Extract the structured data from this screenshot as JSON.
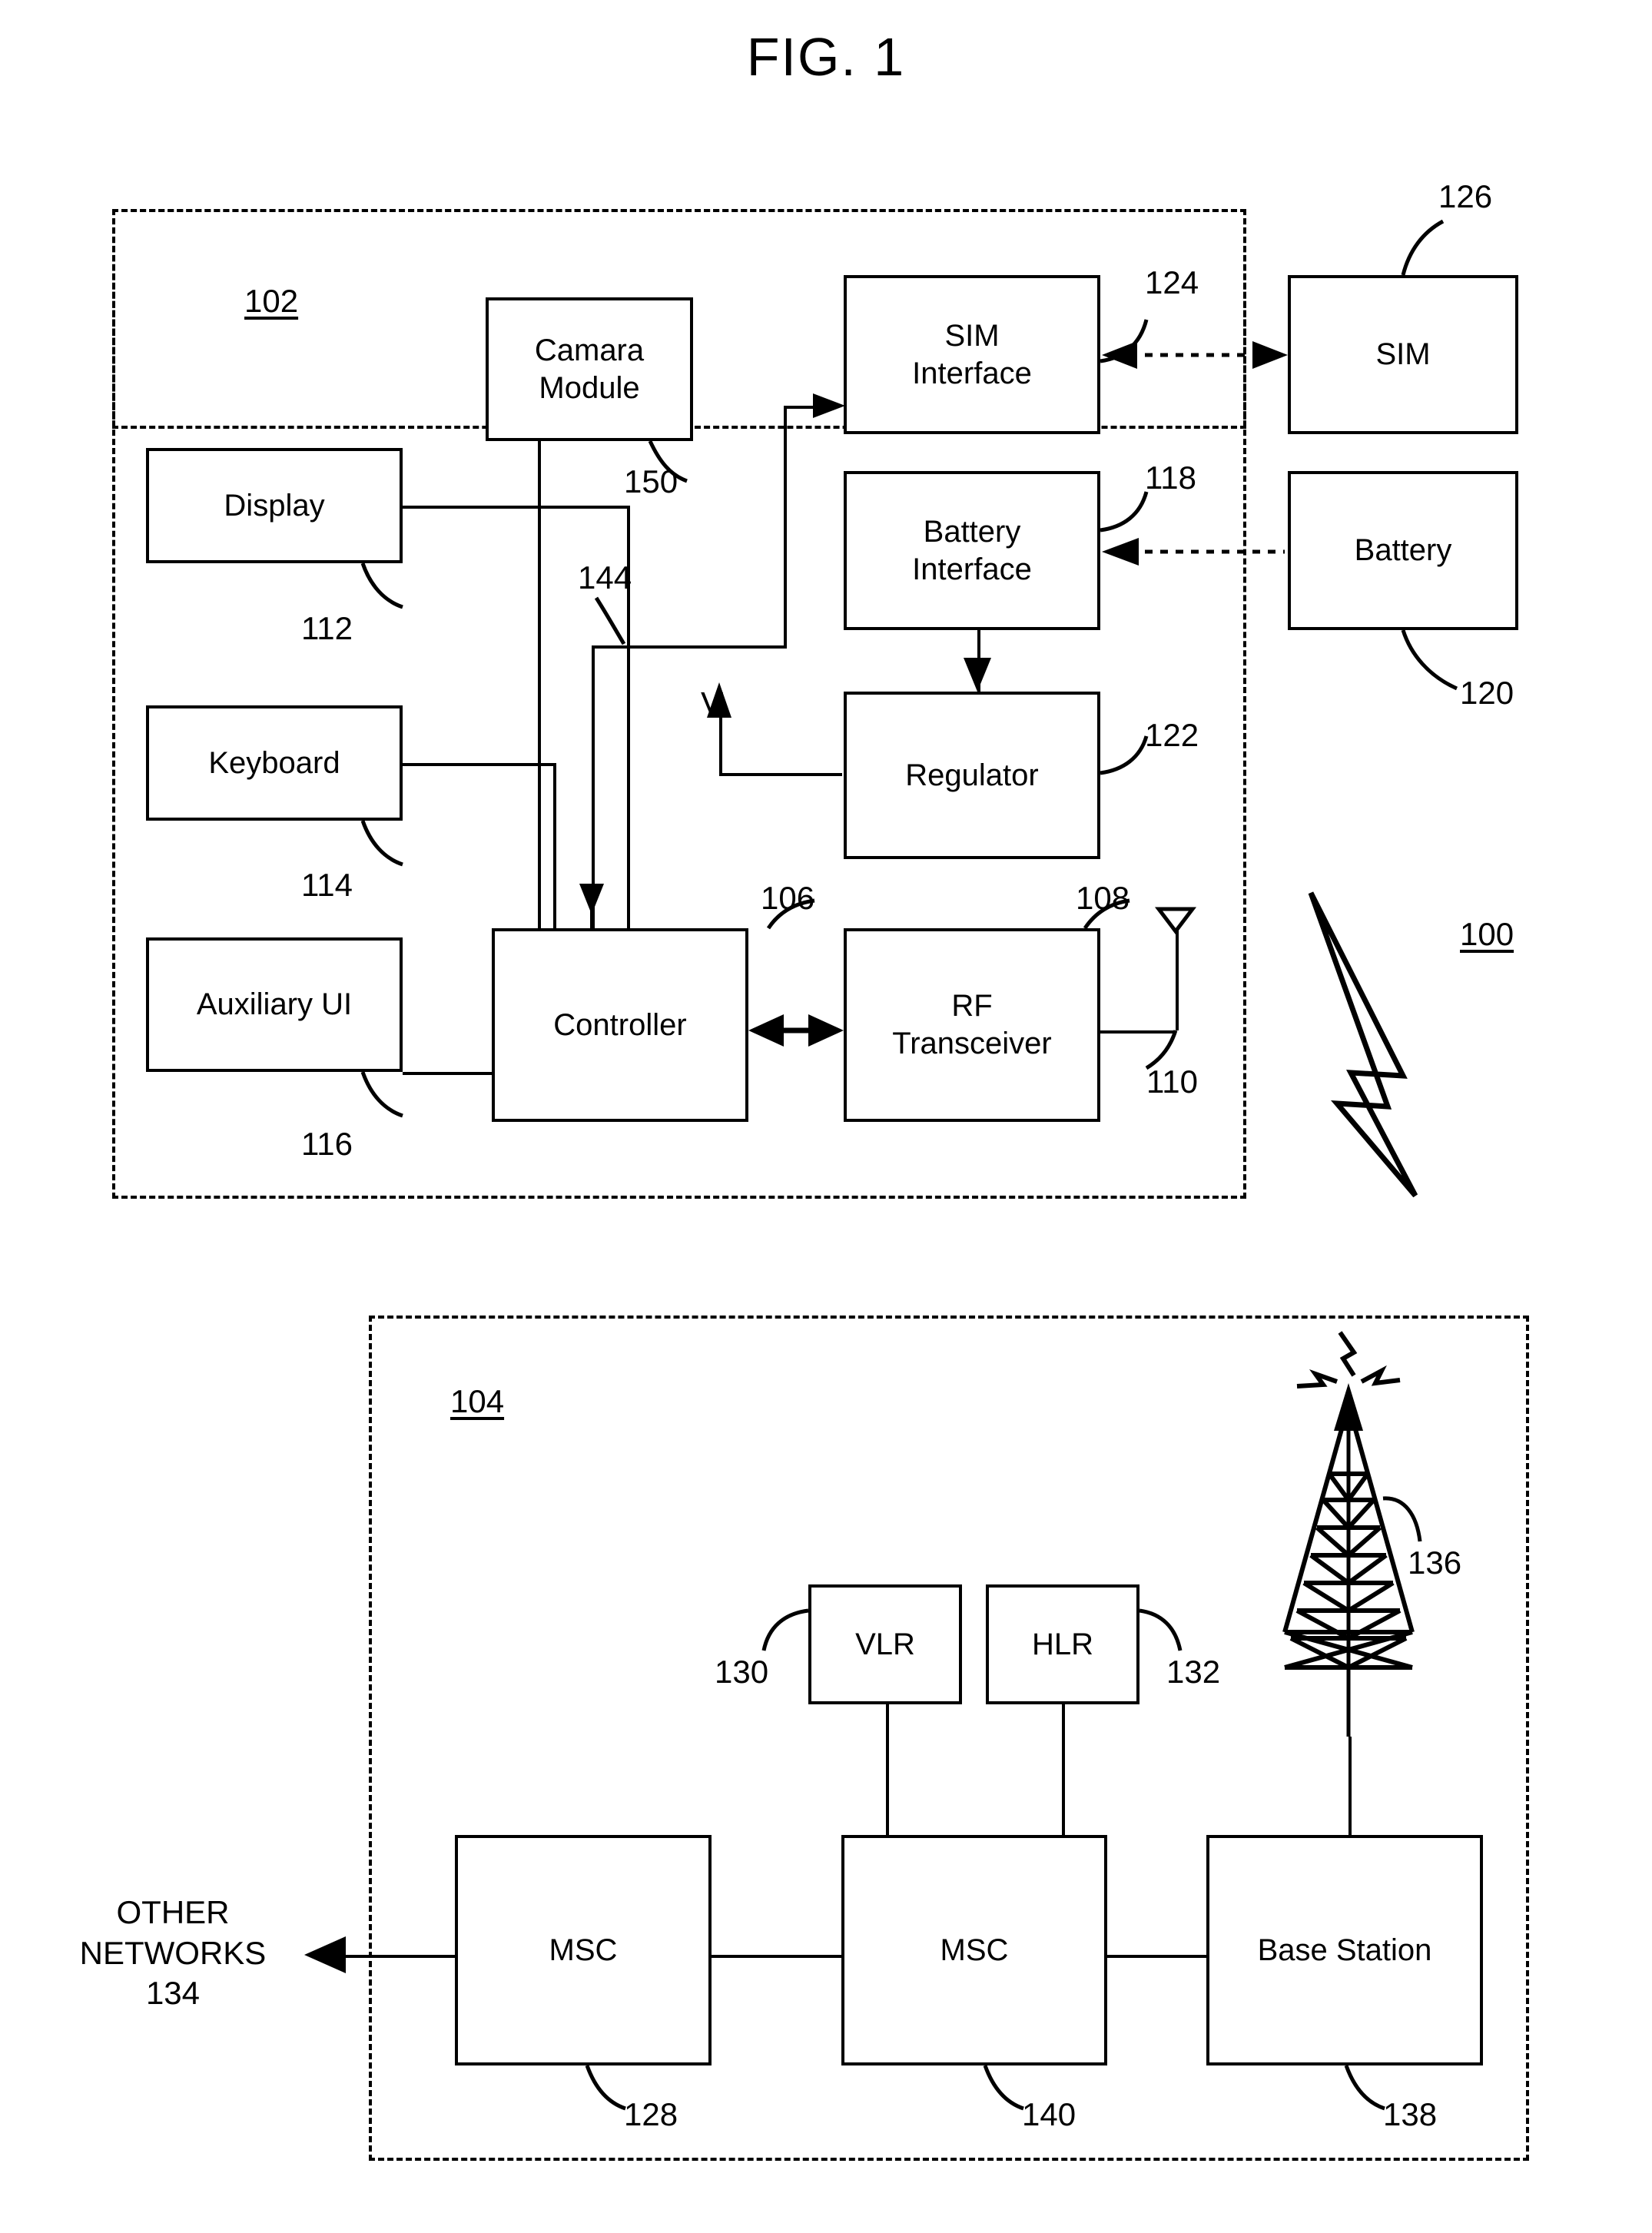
{
  "figure": {
    "title": "FIG. 1",
    "system_ref": "100"
  },
  "mobile_device": {
    "ref": "102",
    "blocks": [
      {
        "name": "display",
        "label": "Display",
        "ref": "112"
      },
      {
        "name": "keyboard",
        "label": "Keyboard",
        "ref": "114"
      },
      {
        "name": "auxiliary-ui",
        "label": "Auxiliary UI",
        "ref": "116"
      },
      {
        "name": "camera-module",
        "label": "Camara\nModule",
        "ref": "150"
      },
      {
        "name": "controller",
        "label": "Controller",
        "ref": "106"
      },
      {
        "name": "rf-transceiver",
        "label": "RF\nTransceiver",
        "ref": "108"
      },
      {
        "name": "sim-interface",
        "label": "SIM\nInterface",
        "ref": "124"
      },
      {
        "name": "battery-interface",
        "label": "Battery\nInterface",
        "ref": "118"
      },
      {
        "name": "regulator",
        "label": "Regulator",
        "ref": "122"
      }
    ],
    "antenna_ref": "110",
    "bus_ref": "144",
    "voltage_label": "V"
  },
  "external_components": [
    {
      "name": "sim",
      "label": "SIM",
      "ref": "126"
    },
    {
      "name": "battery",
      "label": "Battery",
      "ref": "120"
    }
  ],
  "network": {
    "ref": "104",
    "blocks": [
      {
        "name": "vlr",
        "label": "VLR",
        "ref": "130"
      },
      {
        "name": "hlr",
        "label": "HLR",
        "ref": "132"
      },
      {
        "name": "msc-left",
        "label": "MSC",
        "ref": "128"
      },
      {
        "name": "msc-center",
        "label": "MSC",
        "ref": "140"
      },
      {
        "name": "base-station",
        "label": "Base Station",
        "ref": "138"
      }
    ],
    "tower_ref": "136",
    "other_networks": "OTHER\nNETWORKS\n134"
  },
  "colors": {
    "line": "#000000",
    "background": "#ffffff"
  }
}
